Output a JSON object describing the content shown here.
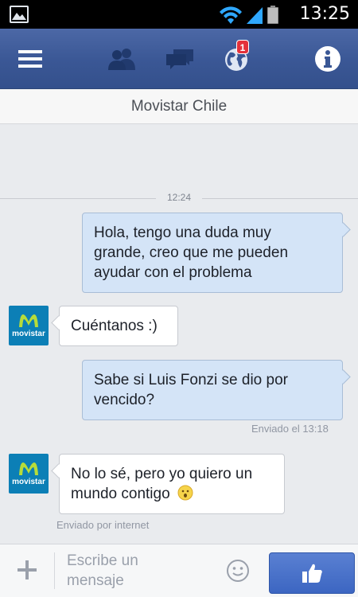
{
  "status_bar": {
    "time": "13:25"
  },
  "top_bar": {
    "notification_count": "1",
    "icons": [
      "menu-icon",
      "friend-requests-icon",
      "messages-icon",
      "globe-notifications-icon",
      "info-icon"
    ]
  },
  "conversation": {
    "title": "Movistar Chile",
    "timestamp_separator": "12:24",
    "messages": [
      {
        "direction": "out",
        "lines": [
          "Hola, tengo una duda muy",
          "grande, creo que me pueden",
          "ayudar con el problema"
        ]
      },
      {
        "direction": "in",
        "sender": "movistar",
        "lines": [
          "Cuéntanos :)"
        ]
      },
      {
        "direction": "out",
        "lines": [
          "Sabe si Luis Fonzi se dio por",
          "vencido?"
        ],
        "meta": "Enviado el 13:18"
      },
      {
        "direction": "in",
        "sender": "movistar",
        "lines": [
          "No lo sé, pero yo quiero un",
          "mundo contigo"
        ],
        "meta": "Enviado por internet"
      }
    ],
    "avatar_label": "movistar"
  },
  "composer": {
    "placeholder_lines": [
      "Escribe un",
      "mensaje"
    ]
  },
  "colors": {
    "fb_blue": "#3a5795",
    "outgoing_bubble": "#d4e4f7",
    "badge_red": "#e4313b",
    "movistar_blue": "#0c7fb6"
  }
}
